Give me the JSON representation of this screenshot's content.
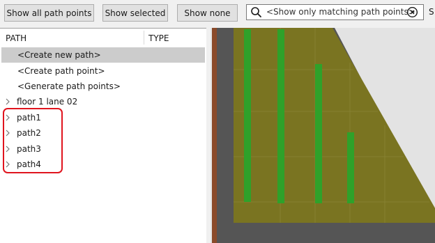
{
  "toolbar": {
    "show_all_label": "Show all path points",
    "show_selected_label": "Show selected",
    "show_none_label": "Show none",
    "search_placeholder": "<Show only matching path points>",
    "cut_label": "S"
  },
  "tree": {
    "columns": {
      "path": "PATH",
      "type": "TYPE"
    },
    "actions": [
      {
        "label": "<Create new path>",
        "selected": true
      },
      {
        "label": "<Create path point>",
        "selected": false
      },
      {
        "label": "<Generate path points>",
        "selected": false
      }
    ],
    "items": [
      {
        "label": "floor 1 lane 02",
        "expandable": true
      },
      {
        "label": "path1",
        "expandable": true
      },
      {
        "label": "path2",
        "expandable": true
      },
      {
        "label": "path3",
        "expandable": true
      },
      {
        "label": "path4",
        "expandable": true
      }
    ]
  },
  "viewport": {
    "floor_color": "#7a7421",
    "lane_color": "#2fa12a",
    "background_color": "#e3e3e3",
    "wall_color": "#555555",
    "edge_color": "#8a4a2a"
  },
  "highlight": {
    "color": "#e0141e"
  }
}
